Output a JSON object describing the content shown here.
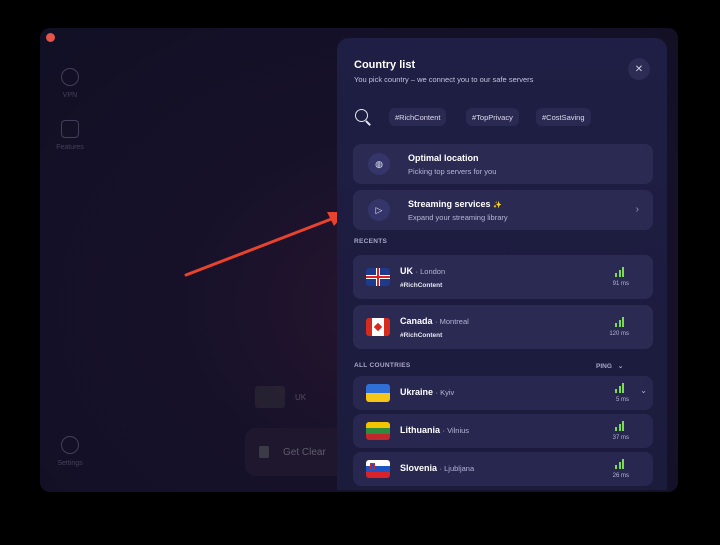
{
  "sidebar": {
    "items": [
      {
        "label": "VPN",
        "icon": "globe-icon"
      },
      {
        "label": "Features",
        "icon": "features-icon"
      },
      {
        "label": "Settings",
        "icon": "settings-icon"
      }
    ]
  },
  "background": {
    "country": "UK",
    "card_label": "Get Clear"
  },
  "panel": {
    "title": "Country list",
    "subtitle": "You pick country – we connect you to our safe servers",
    "close_glyph": "✕",
    "tags": [
      "#RichContent",
      "#TopPrivacy",
      "#CostSaving"
    ],
    "optimal": {
      "title": "Optimal location",
      "subtitle": "Picking top servers for you",
      "icon": "globe-icon"
    },
    "streaming": {
      "title": "Streaming services",
      "subtitle": "Expand your streaming library",
      "icon": "play-icon",
      "badge": "✨"
    },
    "recents_label": "RECENTS",
    "recents": [
      {
        "name": "UK",
        "city": "· London",
        "tag": "#RichContent",
        "ping": "91 ms",
        "flag": "uk"
      },
      {
        "name": "Canada",
        "city": "· Montreal",
        "tag": "#RichContent",
        "ping": "120 ms",
        "flag": "ca"
      }
    ],
    "all_label": "ALL COUNTRIES",
    "ping_label": "PING",
    "countries": [
      {
        "name": "Ukraine",
        "city": "· Kyiv",
        "ping": "5 ms",
        "flag": "ua"
      },
      {
        "name": "Lithuania",
        "city": "· Vilnius",
        "ping": "37 ms",
        "flag": "lt"
      },
      {
        "name": "Slovenia",
        "city": "· Ljubljana",
        "ping": "26 ms",
        "flag": "si"
      }
    ]
  },
  "colors": {
    "accent_arrow": "#e8432e",
    "signal": "#7ed957",
    "panel_bg": "#1f1e44"
  }
}
